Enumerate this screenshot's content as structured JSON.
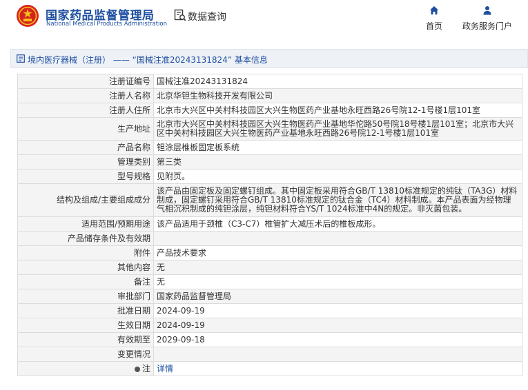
{
  "header": {
    "brand_cn": "国家药品监督管理局",
    "brand_en": "National Medical Products Administration",
    "query_title": "数据查询",
    "nav": [
      {
        "label": "首页",
        "icon": "home-icon"
      },
      {
        "label": "政务服务门户",
        "icon": "user-icon"
      }
    ],
    "accent": "#1e4fa0"
  },
  "breadcrumb": {
    "text": "境内医疗器械（注册） —— “国械注准20243131824” 基本信息"
  },
  "details": [
    {
      "label": "注册证编号",
      "value": "国械注准20243131824"
    },
    {
      "label": "注册人名称",
      "value": "北京华钽生物科技开发有限公司"
    },
    {
      "label": "注册人住所",
      "value": "北京市大兴区中关村科技园区大兴生物医药产业基地永旺西路26号院12-1号楼1层101室"
    },
    {
      "label": "生产地址",
      "value": "北京市大兴区中关村科技园区大兴生物医药产业基地华佗路50号院18号楼1层101室；北京市大兴区中关村科技园区大兴生物医药产业基地永旺西路26号院12-1号楼1层101室"
    },
    {
      "label": "产品名称",
      "value": "钽涂层椎板固定板系统"
    },
    {
      "label": "管理类别",
      "value": "第三类"
    },
    {
      "label": "型号规格",
      "value": "见附页。"
    },
    {
      "label": "结构及组成/主要组成成分",
      "value": "该产品由固定板及固定螺钉组成。其中固定板采用符合GB/T 13810标准规定的纯钛（TA3G）材料制成，固定螺钉采用符合GB/T 13810标准规定的钛合金（TC4）材料制成。本产品表面为经物理气相沉积制成的纯钽涂层，纯钽材料符合YS/T 1024标准中4N的规定。非灭菌包装。"
    },
    {
      "label": "适用范围/预期用途",
      "value": "该产品适用于颈椎（C3-C7）椎管扩大减压术后的椎板成形。"
    },
    {
      "label": "产品储存条件及有效期",
      "value": ""
    },
    {
      "label": "附件",
      "value": "产品技术要求"
    },
    {
      "label": "其他内容",
      "value": "无"
    },
    {
      "label": "备注",
      "value": "无"
    },
    {
      "label": "审批部门",
      "value": "国家药品监督管理局"
    },
    {
      "label": "批准日期",
      "value": "2024-09-19"
    },
    {
      "label": "生效日期",
      "value": "2024-09-19"
    },
    {
      "label": "有效期至",
      "value": "2029-09-18"
    },
    {
      "label": "变更情况",
      "value": ""
    },
    {
      "label": "注",
      "value": "详情"
    }
  ]
}
